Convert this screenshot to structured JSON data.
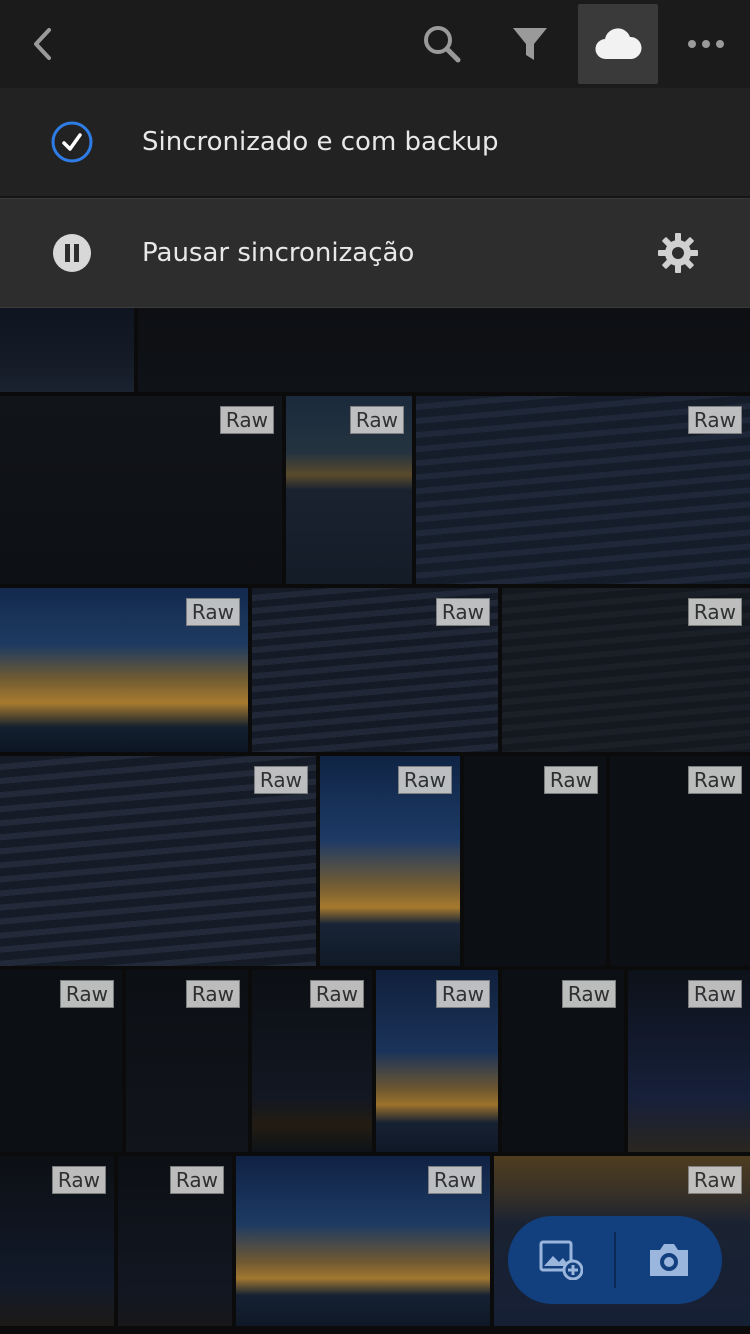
{
  "toolbar": {
    "back_icon": "chevron-left-icon",
    "search_icon": "search-icon",
    "filter_icon": "filter-icon",
    "cloud_icon": "cloud-icon",
    "more_icon": "more-icon"
  },
  "sync_menu": {
    "status_label": "Sincronizado e com backup",
    "pause_label": "Pausar sincronização"
  },
  "grid": {
    "badge_label": "Raw",
    "tiles": [
      {
        "name": "tile-1"
      },
      {
        "name": "tile-2"
      },
      {
        "name": "tile-3"
      },
      {
        "name": "tile-4"
      },
      {
        "name": "tile-5"
      },
      {
        "name": "tile-6"
      },
      {
        "name": "tile-7"
      },
      {
        "name": "tile-8"
      },
      {
        "name": "tile-9"
      },
      {
        "name": "tile-10"
      },
      {
        "name": "tile-11"
      },
      {
        "name": "tile-12"
      },
      {
        "name": "tile-13"
      },
      {
        "name": "tile-14"
      },
      {
        "name": "tile-15"
      },
      {
        "name": "tile-16"
      },
      {
        "name": "tile-17"
      },
      {
        "name": "tile-18"
      },
      {
        "name": "tile-19"
      },
      {
        "name": "tile-20"
      },
      {
        "name": "tile-21"
      },
      {
        "name": "tile-22"
      }
    ]
  },
  "fab": {
    "add_photo_icon": "add-photo-icon",
    "camera_icon": "camera-icon"
  },
  "colors": {
    "accent": "#2f7ce6",
    "fab": "#123f7e"
  }
}
